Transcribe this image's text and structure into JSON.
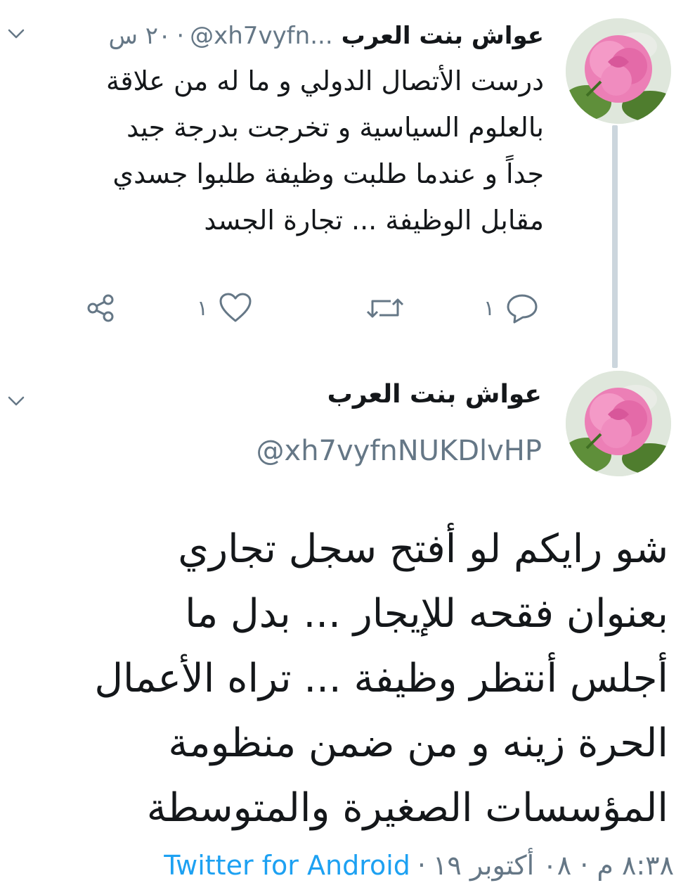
{
  "reply_tweet": {
    "display_name": "عواش بنت العرب",
    "handle_truncated": "@xh7vyfn...",
    "separator": "·",
    "time_ago": "٢٠ س",
    "text_lines": [
      "درست  الأتصال الدولي  و ما له  من علاقة",
      "بالعلوم السياسية  و تخرجت بدرجة جيد",
      "جداً و عندما  طلبت وظيفة  طلبوا جسدي",
      "مقابل الوظيفة ... تجارة الجسد"
    ],
    "actions": {
      "reply_count": "١",
      "retweet_count": "",
      "like_count": "١"
    }
  },
  "main_tweet": {
    "display_name": "عواش بنت العرب",
    "handle": "@xh7vyfnNUKDlvHP",
    "text_lines": [
      "شو رايكم  لو أفتح  سجل تجاري",
      "بعنوان فقحه للإيجار ... بدل  ما",
      "أجلس أنتظر وظيفة  ... تراه الأعمال",
      "الحرة زينه  و من ضمن منظومة",
      "المؤسسات الصغيرة والمتوسطة"
    ],
    "timestamp": "٨:٣٨ م · ٠٨ أكتوبر ١٩",
    "separator": "·",
    "source": "Twitter for Android"
  },
  "icons": {
    "chevron": "chevron-down-icon",
    "reply": "reply-icon",
    "retweet": "retweet-icon",
    "like": "heart-icon",
    "share": "share-icon"
  },
  "colors": {
    "text": "#14171a",
    "secondary": "#657786",
    "link": "#1da1f2",
    "thread_line": "#ccd6dd",
    "icon": "#657786"
  }
}
